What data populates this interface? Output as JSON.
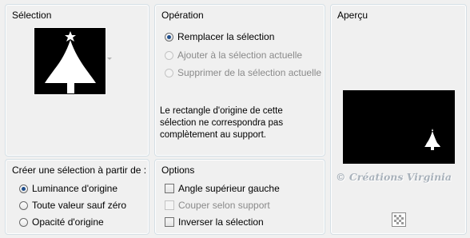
{
  "selection": {
    "title": "Sélection"
  },
  "operation": {
    "title": "Opération",
    "options": [
      {
        "label": "Remplacer la sélection",
        "checked": true,
        "enabled": true
      },
      {
        "label": "Ajouter à la sélection actuelle",
        "checked": false,
        "enabled": false
      },
      {
        "label": "Supprimer de la sélection actuelle",
        "checked": false,
        "enabled": false
      }
    ],
    "note_line1": "Le rectangle d'origine de cette",
    "note_line2": "sélection ne correspondra pas",
    "note_line3": "complètement au support."
  },
  "preview": {
    "title": "Aperçu",
    "watermark": "© Créations Virginia",
    "checker_icon": "checkerboard-icon"
  },
  "create": {
    "title": "Créer une sélection à partir de :",
    "options": [
      {
        "label": "Luminance d'origine",
        "checked": true
      },
      {
        "label": "Toute valeur sauf zéro",
        "checked": false
      },
      {
        "label": "Opacité d'origine",
        "checked": false
      }
    ]
  },
  "options": {
    "title": "Options",
    "items": [
      {
        "label": "Angle supérieur gauche",
        "checked": false,
        "enabled": true
      },
      {
        "label": "Couper selon support",
        "checked": false,
        "enabled": false
      },
      {
        "label": "Inverser la sélection",
        "checked": false,
        "enabled": true
      }
    ]
  }
}
